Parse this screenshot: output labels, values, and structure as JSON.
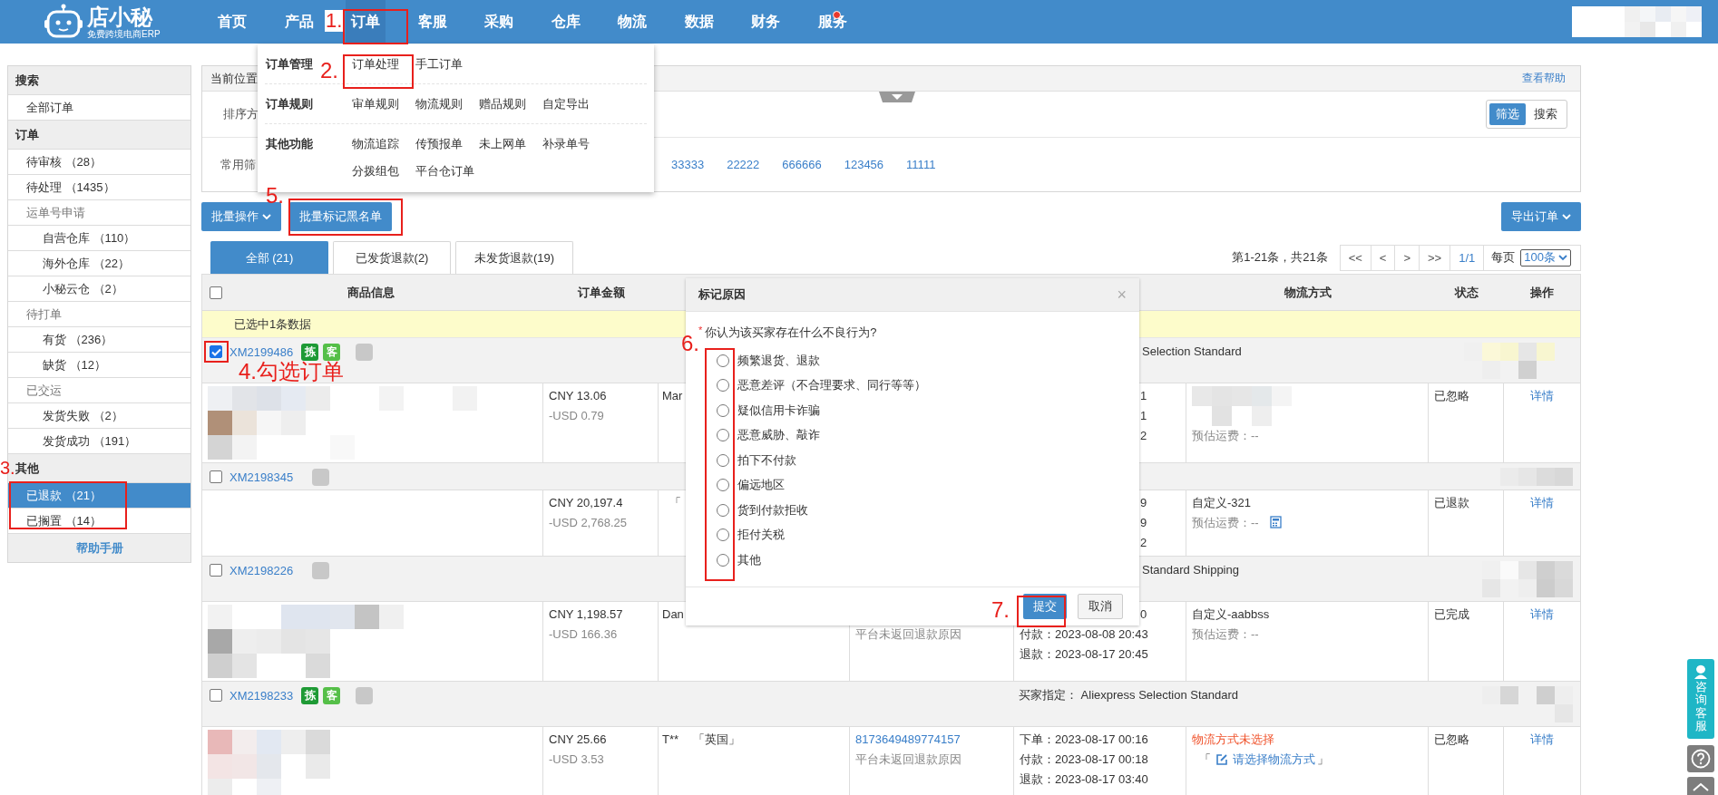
{
  "header": {
    "logo": {
      "name": "店小秘",
      "tagline": "免费跨境电商ERP"
    },
    "nav": [
      {
        "label": "首页",
        "selected": false,
        "notice": false
      },
      {
        "label": "产品",
        "selected": false,
        "notice": false
      },
      {
        "label": "订单",
        "selected": true,
        "notice": false
      },
      {
        "label": "客服",
        "selected": false,
        "notice": false
      },
      {
        "label": "采购",
        "selected": false,
        "notice": false
      },
      {
        "label": "仓库",
        "selected": false,
        "notice": false
      },
      {
        "label": "物流",
        "selected": false,
        "notice": false
      },
      {
        "label": "数据",
        "selected": false,
        "notice": false
      },
      {
        "label": "财务",
        "selected": false,
        "notice": false
      },
      {
        "label": "服务",
        "selected": false,
        "notice": true
      }
    ]
  },
  "menu": {
    "groups": [
      {
        "title": "订单管理",
        "items": [
          "订单处理",
          "手工订单"
        ]
      },
      {
        "title": "订单规则",
        "items": [
          "审单规则",
          "物流规则",
          "赠品规则",
          "自定导出"
        ]
      },
      {
        "title": "其他功能",
        "items": [
          "物流追踪",
          "传预报单",
          "未上网单",
          "补录单号",
          "分拨组包",
          "平台仓订单"
        ]
      }
    ]
  },
  "sidebar": {
    "sections": [
      {
        "title": "搜索",
        "items": [
          {
            "label": "全部订单",
            "selected": false
          }
        ]
      },
      {
        "title": "订单",
        "items": [
          {
            "label": "待审核 （28）",
            "selected": false
          },
          {
            "label": "待处理 （1435）",
            "selected": false
          },
          {
            "label": "运单号申请",
            "selected": false,
            "children": [
              {
                "label": "自营仓库 （110）",
                "selected": false
              },
              {
                "label": "海外仓库 （22）",
                "selected": false
              },
              {
                "label": "小秘云仓 （2）",
                "selected": false
              }
            ]
          },
          {
            "label": "待打单",
            "selected": false,
            "children": [
              {
                "label": "有货 （236）",
                "selected": false
              },
              {
                "label": "缺货 （12）",
                "selected": false
              }
            ]
          },
          {
            "label": "已交运",
            "selected": false,
            "children": [
              {
                "label": "发货失败 （2）",
                "selected": false
              },
              {
                "label": "发货成功 （191）",
                "selected": false
              }
            ]
          }
        ]
      },
      {
        "title": "其他",
        "items": [
          {
            "label": "已退款 （21）",
            "selected": true
          },
          {
            "label": "已搁置 （14）",
            "selected": false
          }
        ]
      }
    ],
    "footer": "帮助手册"
  },
  "filter_panel": {
    "breadcrumb_label": "当前位置",
    "help_link": "查看帮助",
    "sort_label": "排序方",
    "mode_toggle": [
      {
        "label": "筛选",
        "selected": true
      },
      {
        "label": "搜索",
        "selected": false
      }
    ],
    "common_label": "常用筛",
    "common_filters": [
      "33333",
      "22222",
      "666666",
      "123456",
      "11111"
    ]
  },
  "toolbar": {
    "batch_button": "批量操作",
    "blacklist_button": "批量标记黑名单",
    "export_button": "导出订单"
  },
  "tabs": [
    {
      "label": "全部 (21)",
      "selected": true
    },
    {
      "label": "已发货退款(2)",
      "selected": false
    },
    {
      "label": "未发货退款(19)",
      "selected": false
    }
  ],
  "pagination": {
    "summary": "第1-21条，共21条",
    "buttons": [
      "<<",
      "<",
      ">",
      ">>"
    ],
    "page": "1/1",
    "per_page_label": "每页",
    "per_page": "100条"
  },
  "table": {
    "select_all": false,
    "columns": [
      "商品信息",
      "订单金额",
      "物流方式",
      "状态",
      "操作"
    ],
    "selection_notice": "已选中1条数据",
    "orders": [
      {
        "id": "XM2199486",
        "checked": true,
        "badges": [
          {
            "text": "拣",
            "color": "#1e9a35"
          },
          {
            "text": "客",
            "color": "#55bf48"
          }
        ],
        "note": {
          "text": "Selection Standard",
          "kind": "fragment"
        },
        "has_picture": true,
        "amount": "CNY 13.06",
        "refund": "-USD 0.79",
        "buyer": "Mar",
        "times": [
          {
            "text": "1",
            "kind": "fragment"
          },
          {
            "text": "1",
            "kind": "fragment"
          },
          {
            "text": "2",
            "kind": "fragment"
          }
        ],
        "logistics_picture": true,
        "logistics": [
          {
            "text": "预估运费：--",
            "kind": "fee"
          }
        ],
        "status": "已忽略",
        "action": "详情"
      },
      {
        "id": "XM2198345",
        "checked": false,
        "has_picture": false,
        "amount": "CNY 20,197.4",
        "refund": "-USD 2,768.25",
        "country": "「",
        "times": [
          {
            "text": "9",
            "kind": "fragment"
          },
          {
            "text": "9",
            "kind": "fragment"
          },
          {
            "text": "2",
            "kind": "fragment"
          }
        ],
        "logistics_picture": false,
        "logistics": [
          {
            "text": "自定义-321",
            "kind": "method"
          },
          {
            "text": "预估运费：--",
            "kind": "fee",
            "calculator": true
          }
        ],
        "status": "已退款",
        "action": "详情"
      },
      {
        "id": "XM2198226",
        "checked": false,
        "note": {
          "text": "Standard Shipping",
          "kind": "fragment"
        },
        "has_picture": true,
        "amount": "CNY 1,198.57",
        "refund": "-USD 166.36",
        "buyer": "Dan",
        "trade": [
          {
            "kind": "covered"
          },
          {
            "text": "平台未返回退款原因",
            "kind": "muted"
          }
        ],
        "times": [
          {
            "text": "0",
            "kind": "fragment"
          },
          {
            "text": "付款：2023-08-08 20:43",
            "kind": "full"
          },
          {
            "text": "退款：2023-08-17 20:45",
            "kind": "full"
          }
        ],
        "logistics_picture": false,
        "logistics": [
          {
            "text": "自定义-aabbss",
            "kind": "method"
          },
          {
            "text": "预估运费：--",
            "kind": "fee"
          }
        ],
        "status": "已完成",
        "action": "详情"
      },
      {
        "id": "XM2198233",
        "checked": false,
        "badges": [
          {
            "text": "拣",
            "color": "#1e9a35"
          },
          {
            "text": "客",
            "color": "#55bf48"
          }
        ],
        "note": {
          "text": "买家指定：  Aliexpress Selection Standard",
          "kind": "full"
        },
        "has_picture": true,
        "amount": "CNY 25.66",
        "refund": "-USD 3.53",
        "buyer": "T**",
        "country": "「英国」",
        "trade": [
          {
            "text": "8173649489774157",
            "kind": "link"
          },
          {
            "text": "平台未返回退款原因",
            "kind": "muted"
          }
        ],
        "times": [
          {
            "text": "下单：2023-08-17 00:16",
            "kind": "full"
          },
          {
            "text": "付款：2023-08-17 00:18",
            "kind": "full"
          },
          {
            "text": "退款：2023-08-17 03:40",
            "kind": "full"
          }
        ],
        "logistics_picture": false,
        "logistics": [
          {
            "text": "物流方式未选择",
            "kind": "warning"
          },
          {
            "kind": "select_link",
            "open": "「",
            "text": "请选择物流方式",
            "close": "」"
          }
        ],
        "status": "已忽略",
        "action": "详情"
      }
    ]
  },
  "dialog": {
    "title": "标记原因",
    "close": "×",
    "required_mark": "*",
    "question": "你认为该买家存在什么不良行为?",
    "options": [
      {
        "label": "频繁退货、退款",
        "selected": false
      },
      {
        "label": "恶意差评（不合理要求、同行等等）",
        "selected": false
      },
      {
        "label": "疑似信用卡诈骗",
        "selected": false
      },
      {
        "label": "恶意威胁、敲诈",
        "selected": false
      },
      {
        "label": "拍下不付款",
        "selected": false
      },
      {
        "label": "偏远地区",
        "selected": false
      },
      {
        "label": "货到付款拒收",
        "selected": false
      },
      {
        "label": "拒付关税",
        "selected": false
      },
      {
        "label": "其他",
        "selected": false
      }
    ],
    "submit": "提交",
    "cancel": "取消"
  },
  "annotations": [
    {
      "label": "1."
    },
    {
      "label": "2."
    },
    {
      "label": "3."
    },
    {
      "label": "4.勾选订单"
    },
    {
      "label": "5."
    },
    {
      "label": "6."
    },
    {
      "label": "7."
    }
  ],
  "side_widget": {
    "consult": "咨询客服"
  }
}
